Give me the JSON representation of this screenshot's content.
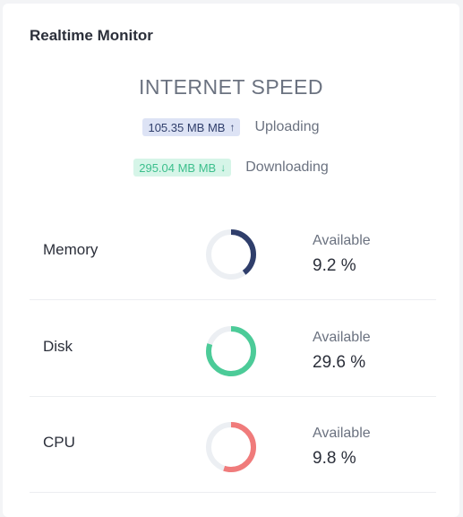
{
  "card": {
    "title": "Realtime Monitor"
  },
  "speed": {
    "title": "INTERNET SPEED",
    "upload": {
      "value": "105.35 MB MB",
      "arrow": "↑",
      "label": "Uploading"
    },
    "download": {
      "value": "295.04 MB MB",
      "arrow": "↓",
      "label": "Downloading"
    }
  },
  "stats": [
    {
      "name": "Memory",
      "avail_label": "Available",
      "avail_value": "9.2 %",
      "ring_fraction": 0.4,
      "ring_color": "#2f3e6b"
    },
    {
      "name": "Disk",
      "avail_label": "Available",
      "avail_value": "29.6 %",
      "ring_fraction": 0.8,
      "ring_color": "#4ccb98"
    },
    {
      "name": "CPU",
      "avail_label": "Available",
      "avail_value": "9.8 %",
      "ring_fraction": 0.55,
      "ring_color": "#f07b7b"
    }
  ],
  "colors": {
    "ring_track": "#eceff3",
    "upload_badge_bg": "#dde3f5",
    "download_badge_bg": "#d6f5e8"
  }
}
